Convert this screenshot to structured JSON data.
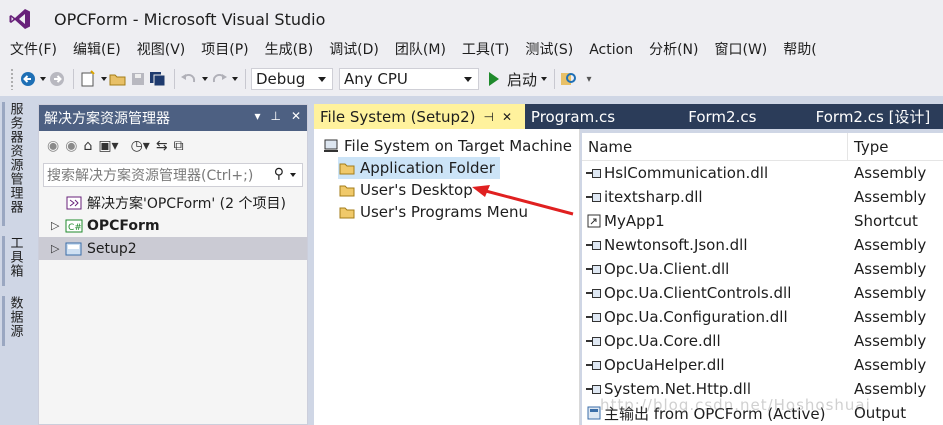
{
  "window": {
    "title": "OPCForm - Microsoft Visual Studio",
    "logo": "vs-logo-icon"
  },
  "menu": [
    "文件(F)",
    "编辑(E)",
    "视图(V)",
    "项目(P)",
    "生成(B)",
    "调试(D)",
    "团队(M)",
    "工具(T)",
    "测试(S)",
    "Action",
    "分析(N)",
    "窗口(W)",
    "帮助("
  ],
  "toolbar": {
    "config": "Debug",
    "platform": "Any CPU",
    "start_label": "启动",
    "colors": {
      "start": "#1f8a2c",
      "back": "#1e6fb5"
    }
  },
  "side_tabs": [
    "服务器资源管理器",
    "工具箱",
    "数据源"
  ],
  "solution_explorer": {
    "title": "解决方案资源管理器",
    "search_placeholder": "搜索解决方案资源管理器(Ctrl+;)",
    "items": [
      {
        "label": "解决方案'OPCForm' (2 个项目)",
        "icon": "solution-icon",
        "bold": false
      },
      {
        "label": "OPCForm",
        "icon": "csharp-project-icon",
        "bold": true
      },
      {
        "label": "Setup2",
        "icon": "setup-project-icon",
        "bold": false,
        "selected": true
      }
    ],
    "colors": {
      "header_bg": "#4d6082"
    }
  },
  "tabs": [
    {
      "label": "File System (Setup2)",
      "active": true
    },
    {
      "label": "Program.cs"
    },
    {
      "label": "Form2.cs"
    },
    {
      "label": "Form2.cs [设计]"
    }
  ],
  "fs_tree": {
    "root": "File System on Target Machine",
    "children": [
      "Application Folder",
      "User's Desktop",
      "User's Programs Menu"
    ]
  },
  "file_list": {
    "columns": [
      "Name",
      "Type"
    ],
    "rows": [
      {
        "name": "HslCommunication.dll",
        "type": "Assembly",
        "icon": "assembly-icon"
      },
      {
        "name": "itextsharp.dll",
        "type": "Assembly",
        "icon": "assembly-icon"
      },
      {
        "name": "MyApp1",
        "type": "Shortcut",
        "icon": "shortcut-icon"
      },
      {
        "name": "Newtonsoft.Json.dll",
        "type": "Assembly",
        "icon": "assembly-icon"
      },
      {
        "name": "Opc.Ua.Client.dll",
        "type": "Assembly",
        "icon": "assembly-icon"
      },
      {
        "name": "Opc.Ua.ClientControls.dll",
        "type": "Assembly",
        "icon": "assembly-icon"
      },
      {
        "name": "Opc.Ua.Configuration.dll",
        "type": "Assembly",
        "icon": "assembly-icon"
      },
      {
        "name": "Opc.Ua.Core.dll",
        "type": "Assembly",
        "icon": "assembly-icon"
      },
      {
        "name": "OpcUaHelper.dll",
        "type": "Assembly",
        "icon": "assembly-icon"
      },
      {
        "name": "System.Net.Http.dll",
        "type": "Assembly",
        "icon": "assembly-icon"
      },
      {
        "name": "主输出 from OPCForm (Active)",
        "type": "Output",
        "icon": "output-icon"
      }
    ]
  },
  "watermark": "http://blog.csdn.net/Hoshoshuai"
}
